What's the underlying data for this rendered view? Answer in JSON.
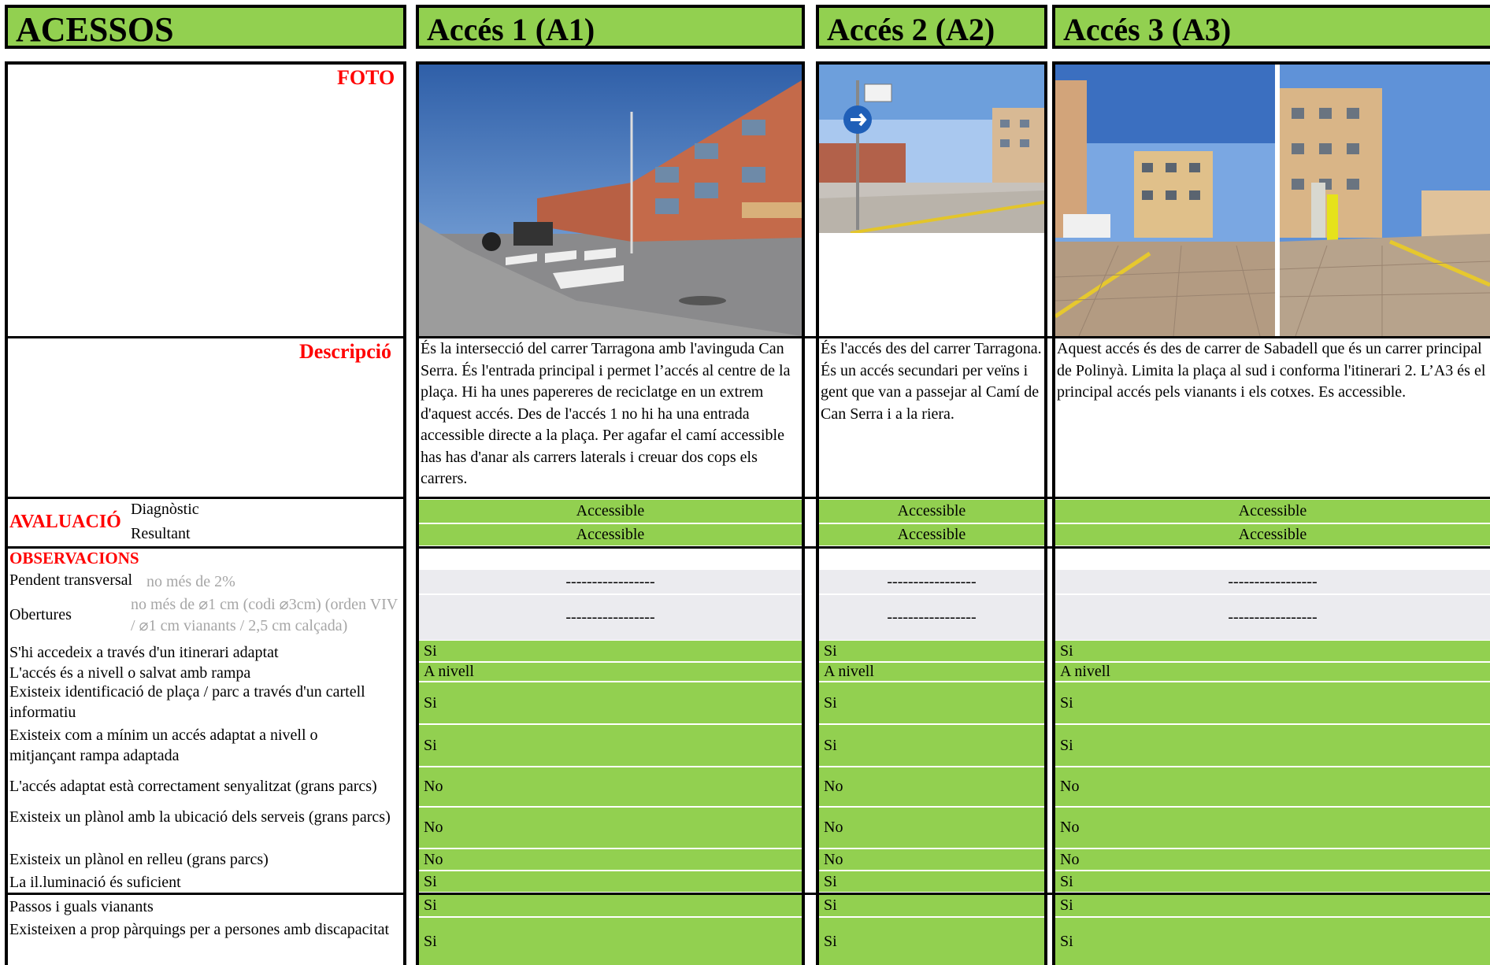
{
  "headers": {
    "main": "ACESSOS",
    "col1": "Accés 1 (A1)",
    "col2": "Accés 2 (A2)",
    "col3": "Accés 3 (A3)"
  },
  "labels": {
    "foto": "FOTO",
    "descripcio": "Descripció",
    "avaluacio": "AVALUACIÓ",
    "diagnostic": "Diagnòstic",
    "resultant": "Resultant",
    "observacions": "OBSERVACIONS",
    "pendent": "Pendent transversal",
    "pendent_sub": "no més de 2%",
    "obertures": "Obertures",
    "obertures_sub": "no més de ⌀1 cm (codi ⌀3cm) (orden VIV / ⌀1 cm vianants / 2,5 cm calçada)"
  },
  "descriptions": {
    "a1": "És la intersecció del carrer Tarragona amb l'avinguda Can Serra. És l'entrada principal i permet l’accés  al centre de la plaça. Hi ha unes papereres de reciclatge en un extrem d'aquest accés. Des de l'accés 1 no hi ha una entrada accessible directe a la plaça. Per agafar el camí accessible has has d'anar als carrers laterals i creuar dos cops els carrers.",
    "a2": "És l'accés des del carrer Tarragona. És un accés secundari per veïns i gent que van a passejar al Camí de Can Serra i a la riera.",
    "a3": "Aquest accés és des de carrer de Sabadell que és un carrer principal de Polinyà. Limita la plaça al sud i conforma l'itinerari 2. L’A3 és el principal accés pels vianants i els cotxes. Es accessible."
  },
  "evaluation": {
    "a1": {
      "diagnostic": "Accessible",
      "resultant": "Accessible"
    },
    "a2": {
      "diagnostic": "Accessible",
      "resultant": "Accessible"
    },
    "a3": {
      "diagnostic": "Accessible",
      "resultant": "Accessible"
    }
  },
  "dashes": "-----------------",
  "rows": [
    {
      "label": "S'hi accedeix a través d'un itinerari adaptat",
      "a1": "Si",
      "a2": "Si",
      "a3": "Si"
    },
    {
      "label": "L'accés és a nivell o salvat amb rampa",
      "a1": "A nivell",
      "a2": "A nivell",
      "a3": "A nivell"
    },
    {
      "label": "Existeix identificació de plaça / parc a través d'un cartell informatiu",
      "a1": "Si",
      "a2": "Si",
      "a3": "Si"
    },
    {
      "label": "Existeix com a mínim un accés adaptat a nivell o mitjançant rampa adaptada",
      "a1": "Si",
      "a2": "Si",
      "a3": "Si"
    },
    {
      "label": "L'accés adaptat està correctament senyalitzat (grans parcs)",
      "a1": "No",
      "a2": "No",
      "a3": "No"
    },
    {
      "label": "Existeix un plànol amb la ubicació dels serveis (grans parcs)",
      "a1": "No",
      "a2": "No",
      "a3": "No"
    },
    {
      "label": "Existeix un plànol en relleu (grans parcs)",
      "a1": "No",
      "a2": "No",
      "a3": "No"
    },
    {
      "label": "La il.luminació és suficient",
      "a1": "Si",
      "a2": "Si",
      "a3": "Si"
    },
    {
      "label": "Passos i guals vianants",
      "a1": "Si",
      "a2": "Si",
      "a3": "Si"
    },
    {
      "label": "Existeixen a prop pàrquings per a persones amb discapacitat",
      "a1": "Si",
      "a2": "Si",
      "a3": "Si"
    }
  ]
}
